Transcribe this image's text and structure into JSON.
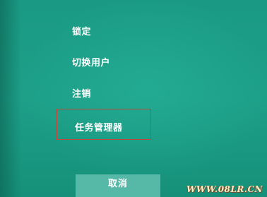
{
  "menu": {
    "items": [
      {
        "label": "锁定"
      },
      {
        "label": "切换用户"
      },
      {
        "label": "注销"
      },
      {
        "label": "任务管理器"
      }
    ]
  },
  "cancel_label": "取消",
  "watermark": "WWW.08LR.CN",
  "colors": {
    "background": "#1b9d86",
    "highlight_border": "#c0473c",
    "button_bg": "#56b8a6",
    "text": "#ffffff"
  }
}
